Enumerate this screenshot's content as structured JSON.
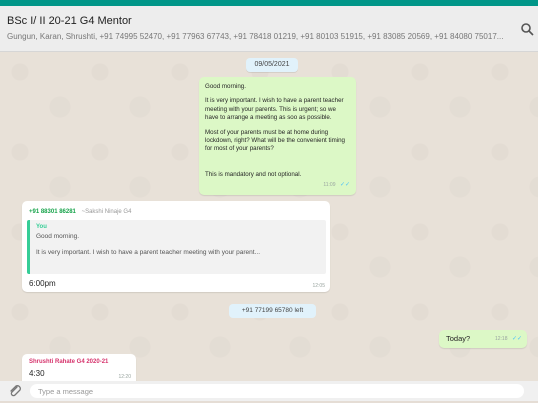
{
  "header": {
    "title": "BSc I/ II 20-21 G4 Mentor",
    "members": "Gungun, Karan, Shrushti, +91 74995 52470, +91 77963 67743, +91 78418 01219, +91 80103 51915, +91 83085 20569, +91 84080 75017..."
  },
  "chat": {
    "date_chip": "09/05/2021",
    "outgoing_notice": {
      "greeting": "Good morning.",
      "para1": "It is very important. I wish to have a parent teacher meeting with your parents. This is urgent; so we have to arrange a meeting as soo  as possible.",
      "para2": "Most of your parents must be at home during lockdown, right? What will be the convenient timing for most of your parents?",
      "para3": "This is mandatory and not optional.",
      "time": "11:09"
    },
    "reply_message": {
      "sender_number": "+91 88301 86281",
      "sender_name": "~Sakshi Ninaje G4",
      "quoted_author": "You",
      "quoted_line1": "Good morning.",
      "quoted_line2": "It is very important. I wish to have a parent teacher meeting with your parent...",
      "body": "6:00pm",
      "time": "12:05"
    },
    "system_message": "+91 77199 65780 left",
    "outgoing_short": {
      "body": "Today?",
      "time": "12:18"
    },
    "incoming_last": {
      "sender": "Shrushti Rahate G4 2020-21",
      "body": "4:30",
      "time": "12:20"
    }
  },
  "composer": {
    "placeholder": "Type a message"
  },
  "icons": {
    "search": "search-icon",
    "attach": "paperclip-icon",
    "read_receipt": "double-check-icon"
  },
  "colors": {
    "accent": "#009688",
    "outgoing_bubble": "#dcf8c6",
    "incoming_bubble": "#ffffff",
    "read_tick": "#4fc3f7"
  }
}
